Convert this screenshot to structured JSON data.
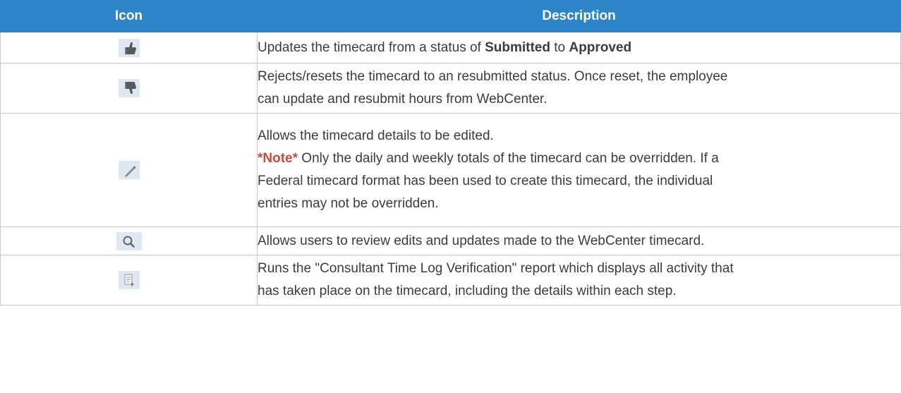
{
  "header": {
    "icon_label": "Icon",
    "description_label": "Description"
  },
  "rows": [
    {
      "icon": "thumbs-up-icon",
      "text_1": "Updates the timecard from a status of ",
      "bold_1": "Submitted",
      "text_2": " to ",
      "bold_2": "Approved"
    },
    {
      "icon": "thumbs-down-icon",
      "line_1": "Rejects/resets the timecard to an resubmitted status. Once reset, the employee",
      "line_2": "can update and resubmit hours from WebCenter."
    },
    {
      "icon": "pencil-edit-icon",
      "line_1": "Allows the timecard details to be edited.",
      "note_label": "*Note*",
      "note_text_1": " Only the daily and weekly totals of the timecard can be overridden. If a",
      "note_text_2": "Federal timecard format has been used to create this timecard, the individual",
      "note_text_3": "entries may not be overridden."
    },
    {
      "icon": "magnifier-icon",
      "line_1": "Allows users to review edits and updates made to the WebCenter timecard."
    },
    {
      "icon": "report-icon",
      "line_1": "Runs the \"Consultant Time Log Verification\" report which displays all activity that",
      "line_2": "has taken place on the timecard, including the details within each step."
    }
  ],
  "colors": {
    "header_bg": "#2d84c7",
    "icon_bg": "#dfe8f2",
    "note": "#d0493d",
    "border": "#c7c7c7"
  }
}
